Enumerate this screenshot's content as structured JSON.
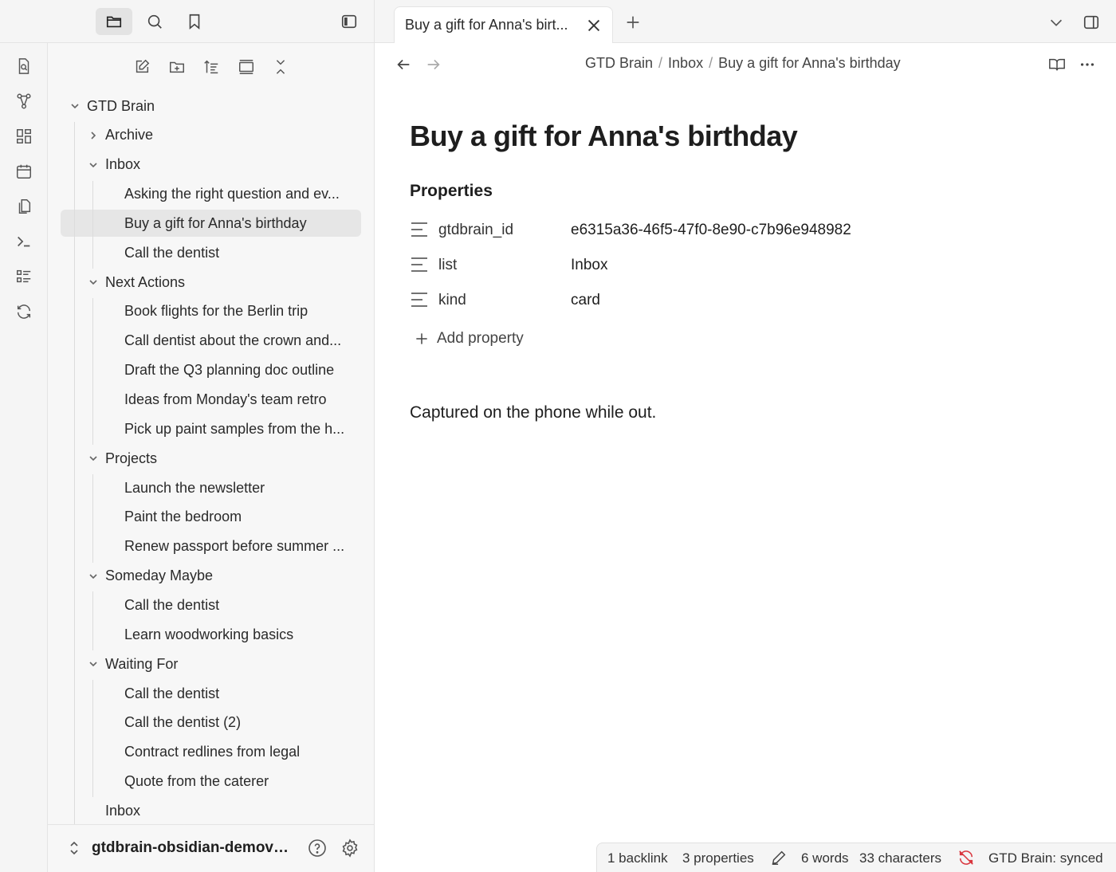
{
  "sidebar_header": {
    "icons": [
      "folder-icon",
      "search-icon",
      "bookmark-icon",
      "sidebar-toggle-icon"
    ]
  },
  "ribbon": {
    "icons": [
      "search-file-icon",
      "graph-icon",
      "canvas-icon",
      "calendar-icon",
      "copy-icon",
      "terminal-icon",
      "list-icon",
      "sync-icon"
    ]
  },
  "nav_actions": [
    "new-note-icon",
    "new-folder-icon",
    "sort-icon",
    "collapse-icon",
    "close-all-icon"
  ],
  "tree": {
    "root": "GTD Brain",
    "items": [
      {
        "label": "GTD Brain",
        "level": 0,
        "type": "folder",
        "expanded": true
      },
      {
        "label": "Archive",
        "level": 1,
        "type": "folder",
        "expanded": false
      },
      {
        "label": "Inbox",
        "level": 1,
        "type": "folder",
        "expanded": true
      },
      {
        "label": "Asking the right question and ev...",
        "level": 2,
        "type": "file"
      },
      {
        "label": "Buy a gift for Anna's birthday",
        "level": 2,
        "type": "file",
        "selected": true
      },
      {
        "label": "Call the dentist",
        "level": 2,
        "type": "file"
      },
      {
        "label": "Next Actions",
        "level": 1,
        "type": "folder",
        "expanded": true
      },
      {
        "label": "Book flights for the Berlin trip",
        "level": 2,
        "type": "file"
      },
      {
        "label": "Call dentist about the crown and...",
        "level": 2,
        "type": "file"
      },
      {
        "label": "Draft the Q3 planning doc outline",
        "level": 2,
        "type": "file"
      },
      {
        "label": "Ideas from Monday's team retro",
        "level": 2,
        "type": "file"
      },
      {
        "label": "Pick up paint samples from the h...",
        "level": 2,
        "type": "file"
      },
      {
        "label": "Projects",
        "level": 1,
        "type": "folder",
        "expanded": true
      },
      {
        "label": "Launch the newsletter",
        "level": 2,
        "type": "file"
      },
      {
        "label": "Paint the bedroom",
        "level": 2,
        "type": "file"
      },
      {
        "label": "Renew passport before summer ...",
        "level": 2,
        "type": "file"
      },
      {
        "label": "Someday Maybe",
        "level": 1,
        "type": "folder",
        "expanded": true
      },
      {
        "label": "Call the dentist",
        "level": 2,
        "type": "file"
      },
      {
        "label": "Learn woodworking basics",
        "level": 2,
        "type": "file"
      },
      {
        "label": "Waiting For",
        "level": 1,
        "type": "folder",
        "expanded": true
      },
      {
        "label": "Call the dentist",
        "level": 2,
        "type": "file"
      },
      {
        "label": "Call the dentist (2)",
        "level": 2,
        "type": "file"
      },
      {
        "label": "Contract redlines from legal",
        "level": 2,
        "type": "file"
      },
      {
        "label": "Quote from the caterer",
        "level": 2,
        "type": "file"
      },
      {
        "label": "Inbox",
        "level": 1,
        "type": "file"
      }
    ]
  },
  "vault": {
    "name": "gtdbrain-obsidian-demova..."
  },
  "tab": {
    "label": "Buy a gift for Anna's birt..."
  },
  "breadcrumb": [
    "GTD Brain",
    "Inbox",
    "Buy a gift for Anna's birthday"
  ],
  "note": {
    "title": "Buy a gift for Anna's birthday",
    "properties_heading": "Properties",
    "properties": [
      {
        "key": "gtdbrain_id",
        "value": "e6315a36-46f5-47f0-8e90-c7b96e948982"
      },
      {
        "key": "list",
        "value": "Inbox"
      },
      {
        "key": "kind",
        "value": "card"
      }
    ],
    "add_property": "Add property",
    "body": "Captured on the phone while out."
  },
  "status": {
    "backlinks": "1 backlink",
    "properties": "3 properties",
    "words": "6 words",
    "characters": "33 characters",
    "sync": "GTD Brain: synced",
    "sync_color": "#d9363e"
  }
}
